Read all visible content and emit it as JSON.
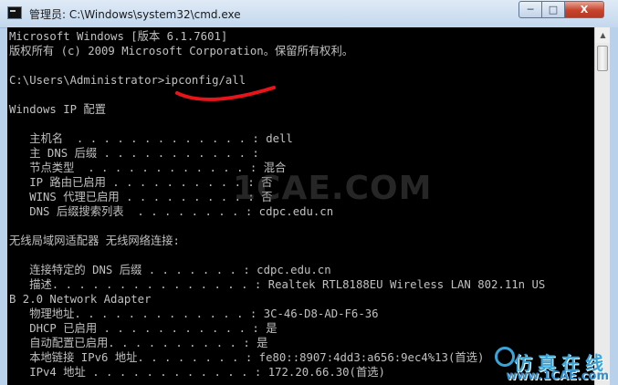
{
  "window": {
    "title": "管理员: C:\\Windows\\system32\\cmd.exe",
    "icon": "cmd-icon",
    "controls": {
      "minimize": "─",
      "maximize": "□",
      "close": "X"
    }
  },
  "console": {
    "lines": [
      "Microsoft Windows [版本 6.1.7601]",
      "版权所有 (c) 2009 Microsoft Corporation。保留所有权利。",
      "",
      "C:\\Users\\Administrator>ipconfig/all",
      "",
      "Windows IP 配置",
      "",
      "   主机名  . . . . . . . . . . . . . : dell",
      "   主 DNS 后缀 . . . . . . . . . . . :",
      "   节点类型  . . . . . . . . . . . . : 混合",
      "   IP 路由已启用 . . . . . . . . . . : 否",
      "   WINS 代理已启用 . . . . . . . . . : 否",
      "   DNS 后缀搜索列表  . . . . . . . . : cdpc.edu.cn",
      "",
      "无线局域网适配器 无线网络连接:",
      "",
      "   连接特定的 DNS 后缀 . . . . . . . : cdpc.edu.cn",
      "   描述. . . . . . . . . . . . . . . : Realtek RTL8188EU Wireless LAN 802.11n US",
      "B 2.0 Network Adapter",
      "   物理地址. . . . . . . . . . . . . : 3C-46-D8-AD-F6-36",
      "   DHCP 已启用 . . . . . . . . . . . : 是",
      "   自动配置已启用. . . . . . . . . . : 是",
      "   本地链接 IPv6 地址. . . . . . . . : fe80::8907:4dd3:a656:9ec4%13(首选)",
      "   IPv4 地址 . . . . . . . . . . . . : 172.20.66.30(首选)"
    ]
  },
  "watermarks": {
    "center": "1CAE.COM",
    "corner_cn": "仿真在线",
    "corner_url": "www.1CAE.com"
  },
  "colors": {
    "console_bg": "#000000",
    "console_fg": "#c0c0c0",
    "annotation": "#e8141a"
  }
}
